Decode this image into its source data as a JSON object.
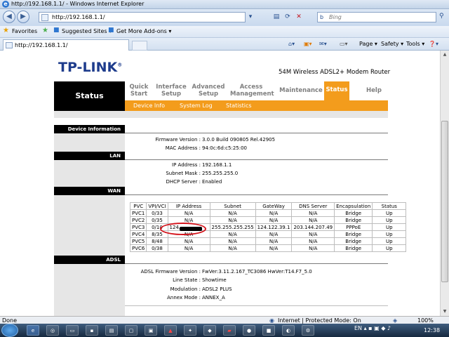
{
  "window": {
    "title": "http://192.168.1.1/ - Windows Internet Explorer"
  },
  "address": {
    "url": "http://192.168.1.1/",
    "search_placeholder": "Bing",
    "search_brand": "b"
  },
  "favorites": {
    "favorites_label": "Favorites",
    "suggested": "Suggested Sites ▾",
    "addons": "Get More Add-ons ▾"
  },
  "tab": {
    "label": "http://192.168.1.1/"
  },
  "commands": {
    "page": "Page ▾",
    "safety": "Safety ▾",
    "tools": "Tools ▾",
    "help": "❓▾"
  },
  "router": {
    "brand": "TP-LINK",
    "reg": "®",
    "product": "54M Wireless ADSL2+ Modem Router",
    "status_label": "Status",
    "menu": [
      {
        "label": "Quick\nStart"
      },
      {
        "label": "Interface\nSetup"
      },
      {
        "label": "Advanced\nSetup"
      },
      {
        "label": "Access\nManagement"
      },
      {
        "label": "Maintenance"
      },
      {
        "label": "Status"
      },
      {
        "label": "Help"
      }
    ],
    "submenu": [
      "Device Info",
      "System Log",
      "Statistics"
    ],
    "sections": {
      "device": "Device Information",
      "lan": "LAN",
      "wan": "WAN",
      "adsl": "ADSL"
    },
    "device": {
      "fw_label": "Firmware Version :",
      "fw_value": "3.0.0 Build 090805 Rel.42905",
      "mac_label": "MAC Address :",
      "mac_value": "94:0c:6d:c5:25:00"
    },
    "lan": {
      "ip_label": "IP Address :",
      "ip_value": "192.168.1.1",
      "mask_label": "Subnet Mask :",
      "mask_value": "255.255.255.0",
      "dhcp_label": "DHCP Server :",
      "dhcp_value": "Enabled"
    },
    "wan_table": {
      "headers": [
        "PVC",
        "VPI/VCI",
        "IP Address",
        "Subnet",
        "GateWay",
        "DNS Server",
        "Encapsulation",
        "Status"
      ],
      "rows": [
        [
          "PVC1",
          "0/33",
          "N/A",
          "N/A",
          "N/A",
          "N/A",
          "Bridge",
          "Up"
        ],
        [
          "PVC2",
          "0/35",
          "N/A",
          "N/A",
          "N/A",
          "N/A",
          "Bridge",
          "Up"
        ],
        [
          "PVC3",
          "0/10",
          "124.",
          "255.255.255.255",
          "124.122.39.1",
          "203.144.207.49",
          "PPPoE",
          "Up"
        ],
        [
          "PVC4",
          "8/35",
          "N/A",
          "N/A",
          "N/A",
          "N/A",
          "Bridge",
          "Up"
        ],
        [
          "PVC5",
          "8/48",
          "N/A",
          "N/A",
          "N/A",
          "N/A",
          "Bridge",
          "Up"
        ],
        [
          "PVC6",
          "0/38",
          "N/A",
          "N/A",
          "N/A",
          "N/A",
          "Bridge",
          "Up"
        ]
      ]
    },
    "adsl": {
      "fw_label": "ADSL Firmware Version :",
      "fw_value": "FwVer:3.11.2.167_TC3086 HwVer:T14.F7_5.0",
      "line_label": "Line State :",
      "line_value": "Showtime",
      "mod_label": "Modulation :",
      "mod_value": "ADSL2 PLUS",
      "annex_label": "Annex Mode :",
      "annex_value": "ANNEX_A"
    }
  },
  "statusbar": {
    "left": "Done",
    "zone": "Internet | Protected Mode: On",
    "zoom": "100%"
  },
  "taskbar": {
    "lang": "EN",
    "clock": "12:38"
  },
  "colors": {
    "accent": "#f39c1c",
    "brand": "#1e3c8c",
    "highlight": "#d4141c"
  }
}
